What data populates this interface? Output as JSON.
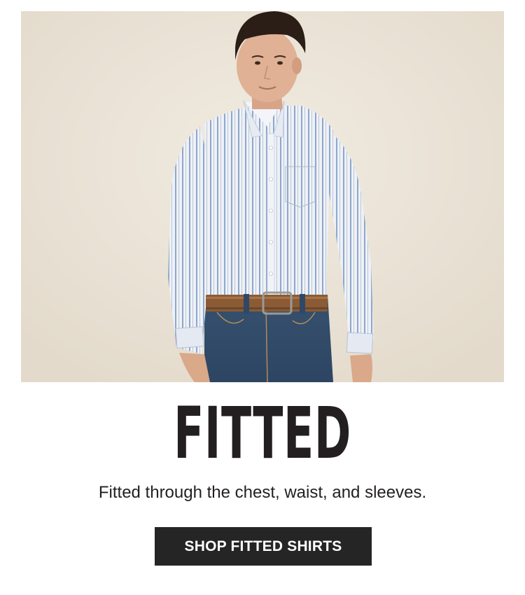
{
  "hero": {
    "image_subject": "model-in-striped-shirt",
    "colors": {
      "background": "#ebe4d7",
      "shirt": "#e7ebf2",
      "stripe": "#8fa7c9",
      "jeans": "#3c5876",
      "belt": "#8a5b35"
    }
  },
  "headline": "FITTED",
  "subtitle": "Fitted through the chest, waist, and sleeves.",
  "cta": {
    "label": "SHOP FITTED SHIRTS",
    "background": "#252525",
    "text_color": "#ffffff"
  }
}
